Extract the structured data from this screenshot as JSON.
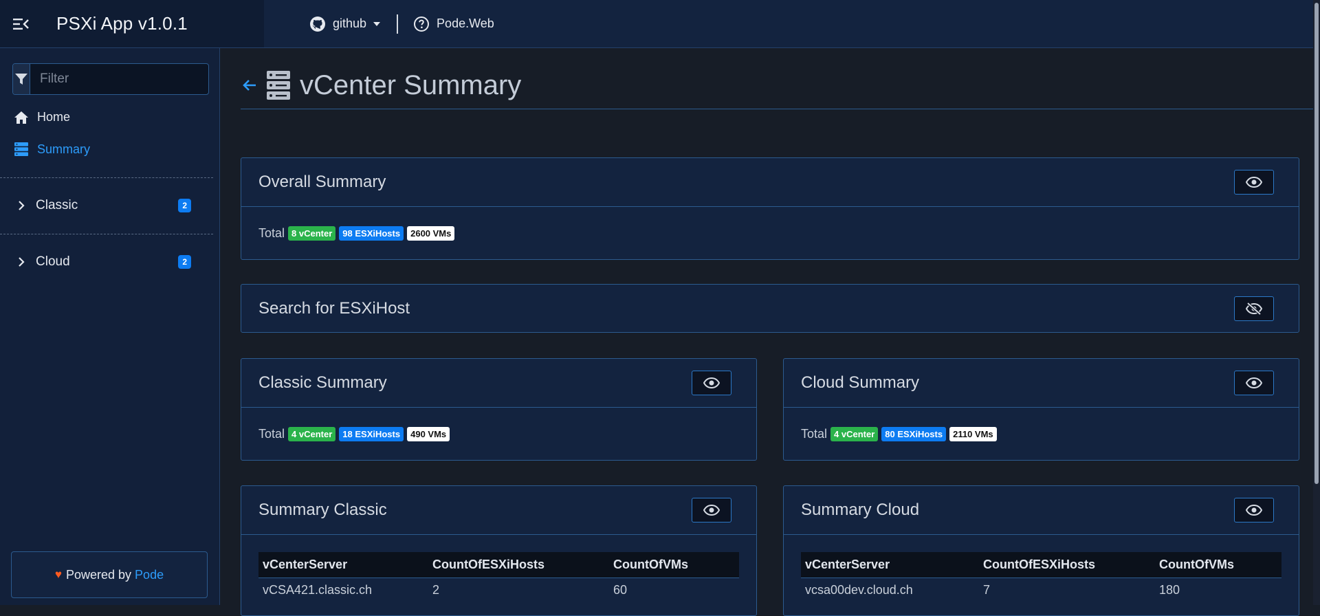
{
  "app": {
    "title": "PSXi App v1.0.1"
  },
  "nav": {
    "github_label": "github",
    "pode_label": "Pode.Web"
  },
  "sidebar": {
    "filter_placeholder": "Filter",
    "items": [
      {
        "label": "Home",
        "icon": "home-icon"
      },
      {
        "label": "Summary",
        "icon": "server-icon",
        "active": true
      }
    ],
    "groups": [
      {
        "label": "Classic",
        "count": "2"
      },
      {
        "label": "Cloud",
        "count": "2"
      }
    ],
    "powered": {
      "prefix": "Powered by",
      "link": "Pode"
    }
  },
  "page": {
    "title": "vCenter Summary"
  },
  "cards": {
    "overall": {
      "title": "Overall Summary",
      "total_label": "Total",
      "badges": {
        "vcenter": "8 vCenter",
        "hosts": "98 ESXiHosts",
        "vms": "2600 VMs"
      }
    },
    "search": {
      "title": "Search for ESXiHost"
    },
    "classic_summary": {
      "title": "Classic Summary",
      "total_label": "Total",
      "badges": {
        "vcenter": "4 vCenter",
        "hosts": "18 ESXiHosts",
        "vms": "490 VMs"
      }
    },
    "cloud_summary": {
      "title": "Cloud Summary",
      "total_label": "Total",
      "badges": {
        "vcenter": "4 vCenter",
        "hosts": "80 ESXiHosts",
        "vms": "2110 VMs"
      }
    },
    "summary_classic": {
      "title": "Summary Classic",
      "columns": [
        "vCenterServer",
        "CountOfESXiHosts",
        "CountOfVMs"
      ],
      "rows": [
        [
          "vCSA421.classic.ch",
          "2",
          "60"
        ]
      ]
    },
    "summary_cloud": {
      "title": "Summary Cloud",
      "columns": [
        "vCenterServer",
        "CountOfESXiHosts",
        "CountOfVMs"
      ],
      "rows": [
        [
          "vcsa00dev.cloud.ch",
          "7",
          "180"
        ]
      ]
    }
  },
  "colors": {
    "accent": "#2d9cfa",
    "navbar": "#13233f",
    "green": "#2bb34b",
    "blue": "#0d7cf2"
  }
}
